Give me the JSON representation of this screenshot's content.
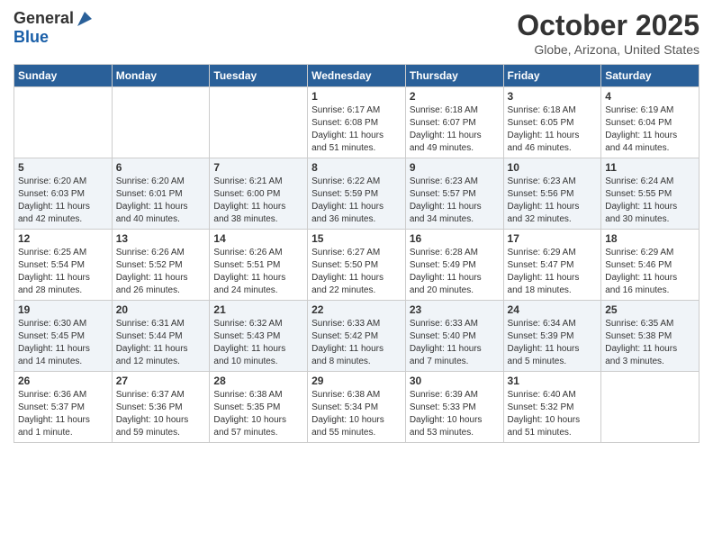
{
  "header": {
    "logo_general": "General",
    "logo_blue": "Blue",
    "month_title": "October 2025",
    "location": "Globe, Arizona, United States"
  },
  "weekdays": [
    "Sunday",
    "Monday",
    "Tuesday",
    "Wednesday",
    "Thursday",
    "Friday",
    "Saturday"
  ],
  "weeks": [
    [
      {
        "day": "",
        "info": ""
      },
      {
        "day": "",
        "info": ""
      },
      {
        "day": "",
        "info": ""
      },
      {
        "day": "1",
        "info": "Sunrise: 6:17 AM\nSunset: 6:08 PM\nDaylight: 11 hours\nand 51 minutes."
      },
      {
        "day": "2",
        "info": "Sunrise: 6:18 AM\nSunset: 6:07 PM\nDaylight: 11 hours\nand 49 minutes."
      },
      {
        "day": "3",
        "info": "Sunrise: 6:18 AM\nSunset: 6:05 PM\nDaylight: 11 hours\nand 46 minutes."
      },
      {
        "day": "4",
        "info": "Sunrise: 6:19 AM\nSunset: 6:04 PM\nDaylight: 11 hours\nand 44 minutes."
      }
    ],
    [
      {
        "day": "5",
        "info": "Sunrise: 6:20 AM\nSunset: 6:03 PM\nDaylight: 11 hours\nand 42 minutes."
      },
      {
        "day": "6",
        "info": "Sunrise: 6:20 AM\nSunset: 6:01 PM\nDaylight: 11 hours\nand 40 minutes."
      },
      {
        "day": "7",
        "info": "Sunrise: 6:21 AM\nSunset: 6:00 PM\nDaylight: 11 hours\nand 38 minutes."
      },
      {
        "day": "8",
        "info": "Sunrise: 6:22 AM\nSunset: 5:59 PM\nDaylight: 11 hours\nand 36 minutes."
      },
      {
        "day": "9",
        "info": "Sunrise: 6:23 AM\nSunset: 5:57 PM\nDaylight: 11 hours\nand 34 minutes."
      },
      {
        "day": "10",
        "info": "Sunrise: 6:23 AM\nSunset: 5:56 PM\nDaylight: 11 hours\nand 32 minutes."
      },
      {
        "day": "11",
        "info": "Sunrise: 6:24 AM\nSunset: 5:55 PM\nDaylight: 11 hours\nand 30 minutes."
      }
    ],
    [
      {
        "day": "12",
        "info": "Sunrise: 6:25 AM\nSunset: 5:54 PM\nDaylight: 11 hours\nand 28 minutes."
      },
      {
        "day": "13",
        "info": "Sunrise: 6:26 AM\nSunset: 5:52 PM\nDaylight: 11 hours\nand 26 minutes."
      },
      {
        "day": "14",
        "info": "Sunrise: 6:26 AM\nSunset: 5:51 PM\nDaylight: 11 hours\nand 24 minutes."
      },
      {
        "day": "15",
        "info": "Sunrise: 6:27 AM\nSunset: 5:50 PM\nDaylight: 11 hours\nand 22 minutes."
      },
      {
        "day": "16",
        "info": "Sunrise: 6:28 AM\nSunset: 5:49 PM\nDaylight: 11 hours\nand 20 minutes."
      },
      {
        "day": "17",
        "info": "Sunrise: 6:29 AM\nSunset: 5:47 PM\nDaylight: 11 hours\nand 18 minutes."
      },
      {
        "day": "18",
        "info": "Sunrise: 6:29 AM\nSunset: 5:46 PM\nDaylight: 11 hours\nand 16 minutes."
      }
    ],
    [
      {
        "day": "19",
        "info": "Sunrise: 6:30 AM\nSunset: 5:45 PM\nDaylight: 11 hours\nand 14 minutes."
      },
      {
        "day": "20",
        "info": "Sunrise: 6:31 AM\nSunset: 5:44 PM\nDaylight: 11 hours\nand 12 minutes."
      },
      {
        "day": "21",
        "info": "Sunrise: 6:32 AM\nSunset: 5:43 PM\nDaylight: 11 hours\nand 10 minutes."
      },
      {
        "day": "22",
        "info": "Sunrise: 6:33 AM\nSunset: 5:42 PM\nDaylight: 11 hours\nand 8 minutes."
      },
      {
        "day": "23",
        "info": "Sunrise: 6:33 AM\nSunset: 5:40 PM\nDaylight: 11 hours\nand 7 minutes."
      },
      {
        "day": "24",
        "info": "Sunrise: 6:34 AM\nSunset: 5:39 PM\nDaylight: 11 hours\nand 5 minutes."
      },
      {
        "day": "25",
        "info": "Sunrise: 6:35 AM\nSunset: 5:38 PM\nDaylight: 11 hours\nand 3 minutes."
      }
    ],
    [
      {
        "day": "26",
        "info": "Sunrise: 6:36 AM\nSunset: 5:37 PM\nDaylight: 11 hours\nand 1 minute."
      },
      {
        "day": "27",
        "info": "Sunrise: 6:37 AM\nSunset: 5:36 PM\nDaylight: 10 hours\nand 59 minutes."
      },
      {
        "day": "28",
        "info": "Sunrise: 6:38 AM\nSunset: 5:35 PM\nDaylight: 10 hours\nand 57 minutes."
      },
      {
        "day": "29",
        "info": "Sunrise: 6:38 AM\nSunset: 5:34 PM\nDaylight: 10 hours\nand 55 minutes."
      },
      {
        "day": "30",
        "info": "Sunrise: 6:39 AM\nSunset: 5:33 PM\nDaylight: 10 hours\nand 53 minutes."
      },
      {
        "day": "31",
        "info": "Sunrise: 6:40 AM\nSunset: 5:32 PM\nDaylight: 10 hours\nand 51 minutes."
      },
      {
        "day": "",
        "info": ""
      }
    ]
  ]
}
